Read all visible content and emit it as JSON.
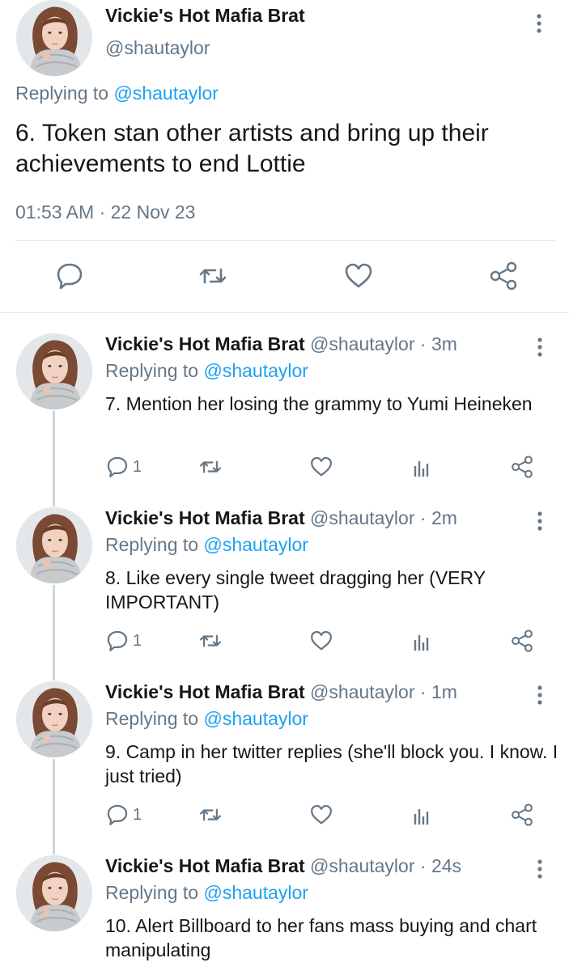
{
  "main_tweet": {
    "display_name": "Vickie's Hot Mafia Brat",
    "handle": "@shautaylor",
    "replying_prefix": "Replying to",
    "replying_handle": "@shautaylor",
    "text": "6. Token stan other artists and bring up their achievements to end Lottie",
    "timestamp": "01:53 AM · 22 Nov 23",
    "actions": [
      "reply-icon",
      "retweet-icon",
      "like-icon",
      "share-icon"
    ]
  },
  "replies": [
    {
      "display_name": "Vickie's Hot Mafia Brat",
      "handle": "@shautaylor",
      "time": "· 3m",
      "replying_prefix": "Replying to",
      "replying_handle": "@shautaylor",
      "text": "7. Mention her losing the grammy to  Yumi Heineken",
      "reply_count": "1"
    },
    {
      "display_name": "Vickie's Hot Mafia Brat",
      "handle": "@shautaylor",
      "time": "· 2m",
      "replying_prefix": "Replying to",
      "replying_handle": "@shautaylor",
      "text": "8. Like every single tweet dragging her (VERY IMPORTANT)",
      "reply_count": "1"
    },
    {
      "display_name": "Vickie's Hot Mafia Brat",
      "handle": "@shautaylor",
      "time": "· 1m",
      "replying_prefix": "Replying to",
      "replying_handle": "@shautaylor",
      "text": "9. Camp in her twitter replies (she'll block you. I know. I just tried)",
      "reply_count": "1"
    },
    {
      "display_name": "Vickie's Hot Mafia Brat",
      "handle": "@shautaylor",
      "time": "· 24s",
      "replying_prefix": "Replying to",
      "replying_handle": "@shautaylor",
      "text": "10. Alert Billboard to her fans mass buying and chart manipulating"
    }
  ],
  "colors": {
    "accent": "#1da1f2",
    "muted": "#657786",
    "text": "#14171a"
  }
}
